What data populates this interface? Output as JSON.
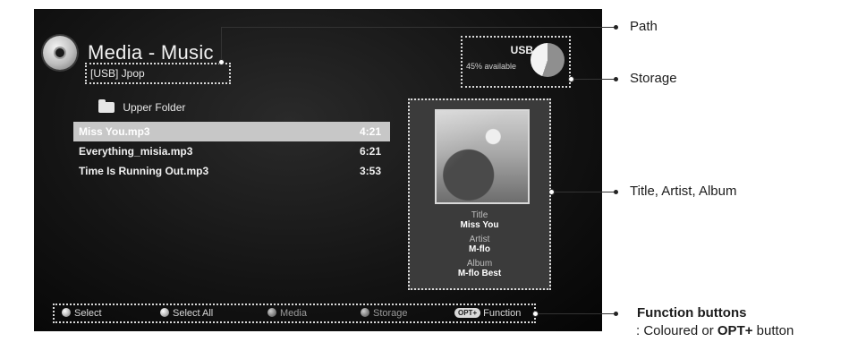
{
  "screen": {
    "title": "Media - Music",
    "path": "[USB] Jpop",
    "storage": {
      "device": "USB",
      "available": "45% available",
      "available_percent": 45
    },
    "upper_folder": "Upper Folder",
    "files": [
      {
        "name": "Miss You.mp3",
        "duration": "4:21",
        "selected": true
      },
      {
        "name": "Everything_misia.mp3",
        "duration": "6:21",
        "selected": false
      },
      {
        "name": "Time Is Running Out.mp3",
        "duration": "3:53",
        "selected": false
      }
    ],
    "info": {
      "title_label": "Title",
      "title_value": "Miss You",
      "artist_label": "Artist",
      "artist_value": "M-flo",
      "album_label": "Album",
      "album_value": "M-flo Best"
    },
    "function_bar": {
      "select": "Select",
      "select_all": "Select All",
      "media": "Media",
      "storage": "Storage",
      "opt_badge": "OPT+",
      "function": "Function"
    }
  },
  "callouts": {
    "path": "Path",
    "storage": "Storage",
    "title_artist_album": "Title, Artist, Album",
    "function_buttons": "Function buttons",
    "function_sub_prefix": ": Coloured or ",
    "function_sub_bold": "OPT+",
    "function_sub_suffix": " button"
  }
}
